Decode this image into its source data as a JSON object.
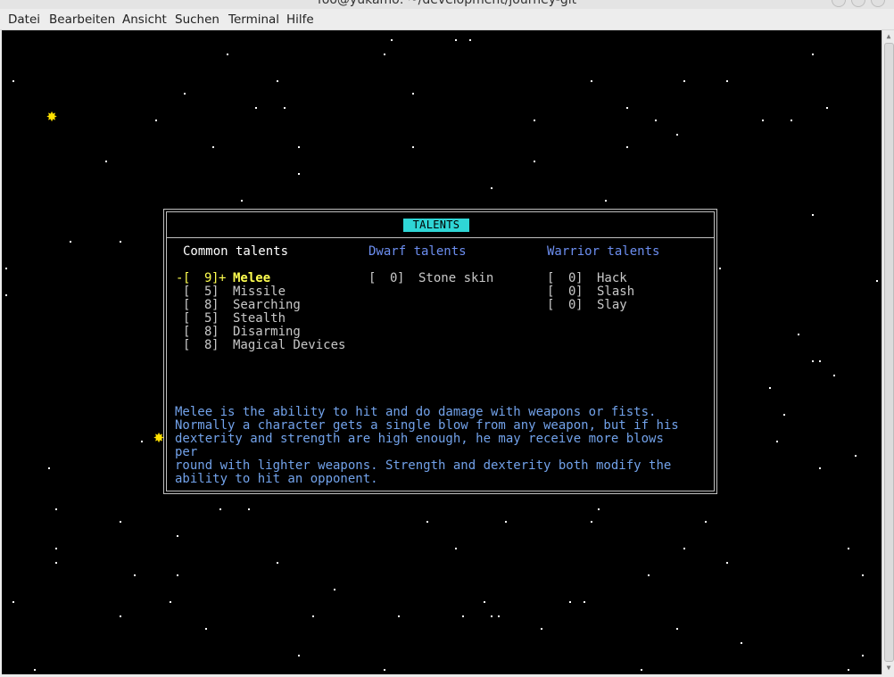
{
  "window": {
    "title": "foo@yukamo: ~/development/journey-git"
  },
  "menu": {
    "items": [
      "Datei",
      "Bearbeiten",
      "Ansicht",
      "Suchen",
      "Terminal",
      "Hilfe"
    ]
  },
  "dialog": {
    "title": "TALENTS",
    "columns": [
      {
        "heading": "Common talents",
        "active": true,
        "rows": [
          {
            "value": "9",
            "name": "Melee",
            "selected": true
          },
          {
            "value": "5",
            "name": "Missile"
          },
          {
            "value": "8",
            "name": "Searching"
          },
          {
            "value": "5",
            "name": "Stealth"
          },
          {
            "value": "8",
            "name": "Disarming"
          },
          {
            "value": "8",
            "name": "Magical Devices"
          }
        ]
      },
      {
        "heading": "Dwarf talents",
        "active": false,
        "rows": [
          {
            "value": "0",
            "name": "Stone skin"
          }
        ]
      },
      {
        "heading": "Warrior talents",
        "active": false,
        "rows": [
          {
            "value": "0",
            "name": "Hack"
          },
          {
            "value": "0",
            "name": "Slash"
          },
          {
            "value": "0",
            "name": "Slay"
          }
        ]
      }
    ],
    "selection_markers": {
      "left": "-",
      "right": "+"
    },
    "description": "Melee is the ability to hit and do damage with weapons or fists.\nNormally a character gets a single blow from any weapon, but if his\ndexterity and strength are high enough, he may receive more blows per\nround with lighter weapons. Strength and dexterity both modify the\nability to hit an opponent."
  },
  "colors": {
    "terminal_bg": "#000000",
    "star": "#ffffff",
    "sun": "#ffe100",
    "title_highlight": "#2fd6d6",
    "selected_text": "#ffff50",
    "inactive_heading": "#6c8ef0",
    "description_text": "#72a2ea"
  },
  "icons": {
    "sun": "sun-icon",
    "star": "star-dot"
  }
}
